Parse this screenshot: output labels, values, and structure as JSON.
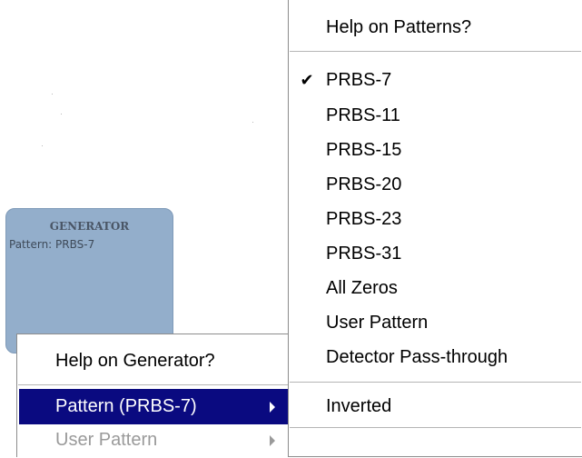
{
  "generator_block": {
    "title": "GENERATOR",
    "pattern_text": "Pattern: PRBS-7"
  },
  "context_menu": {
    "items": [
      {
        "label": "Help on Generator?",
        "state": "normal",
        "has_submenu": false
      },
      {
        "label": "Pattern (PRBS-7)",
        "state": "highlighted",
        "has_submenu": true
      },
      {
        "label": "User Pattern",
        "state": "disabled",
        "has_submenu": true
      }
    ]
  },
  "pattern_submenu": {
    "help": "Help on Patterns?",
    "check_mark": "✔",
    "selected": "PRBS-7",
    "options": [
      "PRBS-7",
      "PRBS-11",
      "PRBS-15",
      "PRBS-20",
      "PRBS-23",
      "PRBS-31",
      "All Zeros",
      "User Pattern",
      "Detector Pass-through"
    ],
    "inverted": "Inverted"
  },
  "colors": {
    "highlight": "#0a0a80",
    "generator_block": "#93aecb",
    "disabled_text": "#9a9a9a"
  }
}
